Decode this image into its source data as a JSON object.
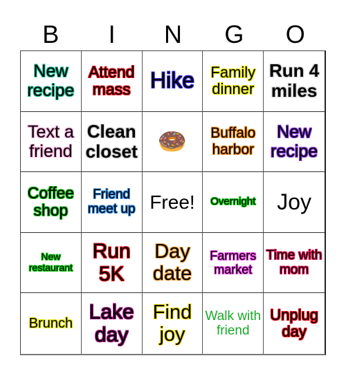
{
  "header": {
    "letters": [
      "B",
      "I",
      "N",
      "G",
      "O"
    ]
  },
  "cells": [
    {
      "text": "New recipe",
      "glow": "#1fb58f",
      "color": "#000000",
      "size": 25,
      "bold": false
    },
    {
      "text": "Attend mass",
      "glow": "#e8141c",
      "color": "#000000",
      "size": 23,
      "bold": false
    },
    {
      "text": "Hike",
      "glow": "#3a2ee6",
      "color": "#000000",
      "size": 32,
      "bold": false
    },
    {
      "text": "Family dinner",
      "glow": "#e6e600",
      "color": "#000000",
      "size": 22,
      "bold": false
    },
    {
      "text": "Run 4 miles",
      "glow": "#cccccc",
      "color": "#000000",
      "size": 26,
      "bold": true
    },
    {
      "text": "Text a friend",
      "glow": "#f7a8d8",
      "color": "#000000",
      "size": 25,
      "bold": false
    },
    {
      "text": "Clean closet",
      "glow": "#cccccc",
      "color": "#000000",
      "size": 26,
      "bold": true
    },
    {
      "text": "🍩",
      "glow": "",
      "color": "#000000",
      "size": 34,
      "bold": false,
      "icon": "donut-icon"
    },
    {
      "text": "Buffalo harbor",
      "glow": "#f08a1c",
      "color": "#000000",
      "size": 21,
      "bold": false
    },
    {
      "text": "New recipe",
      "glow": "#8a3ae6",
      "color": "#000000",
      "size": 25,
      "bold": false
    },
    {
      "text": "Coffee shop",
      "glow": "#18b818",
      "color": "#000000",
      "size": 23,
      "bold": false
    },
    {
      "text": "Friend meet up",
      "glow": "#3a8ee6",
      "color": "#000000",
      "size": 19,
      "bold": false
    },
    {
      "text": "Free!",
      "glow": "",
      "color": "#000000",
      "size": 28,
      "bold": false
    },
    {
      "text": "Overnight",
      "glow": "#18c818",
      "color": "#000000",
      "size": 15,
      "bold": false
    },
    {
      "text": "Joy",
      "glow": "",
      "color": "#000000",
      "size": 32,
      "bold": false
    },
    {
      "text": "New restaurant",
      "glow": "#18c818",
      "color": "#000000",
      "size": 14,
      "bold": false
    },
    {
      "text": "Run 5K",
      "glow": "#e8141c",
      "color": "#000000",
      "size": 30,
      "bold": false
    },
    {
      "text": "Day date",
      "glow": "#f0a040",
      "color": "#000000",
      "size": 29,
      "bold": false
    },
    {
      "text": "Farmers market",
      "glow": "#f050e8",
      "color": "#000000",
      "size": 18,
      "bold": false
    },
    {
      "text": "Time with mom",
      "glow": "#e8185a",
      "color": "#000000",
      "size": 19,
      "bold": false
    },
    {
      "text": "Brunch",
      "glow": "#e6e600",
      "color": "#000000",
      "size": 20,
      "bold": false
    },
    {
      "text": "Lake day",
      "glow": "#a0107e",
      "color": "#000000",
      "size": 30,
      "bold": false
    },
    {
      "text": "Find joy",
      "glow": "#f0e020",
      "color": "#000000",
      "size": 29,
      "bold": false
    },
    {
      "text": "Walk with friend",
      "glow": "",
      "color": "#1aa82a",
      "size": 19,
      "bold": false
    },
    {
      "text": "Unplug day",
      "glow": "#e8141c",
      "color": "#000000",
      "size": 22,
      "bold": false
    }
  ]
}
